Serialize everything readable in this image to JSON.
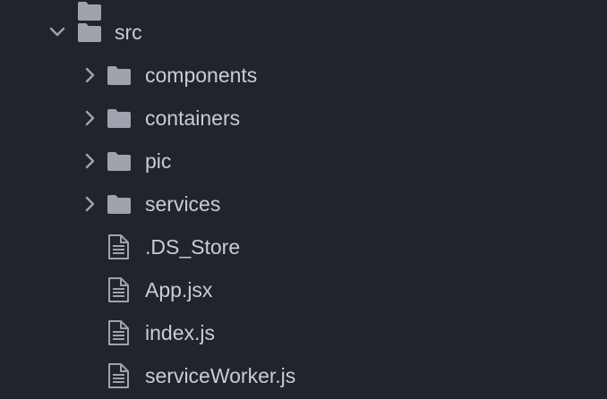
{
  "colors": {
    "background": "#21252b",
    "text": "#c8ccd4",
    "icon": "#9ea3ad",
    "chevron": "#9ea3ad"
  },
  "tree": {
    "root": {
      "label": "src",
      "expanded": true,
      "icon": "folder-icon"
    },
    "children": [
      {
        "label": "components",
        "type": "folder",
        "expanded": false,
        "icon": "folder-icon"
      },
      {
        "label": "containers",
        "type": "folder",
        "expanded": false,
        "icon": "folder-icon"
      },
      {
        "label": "pic",
        "type": "folder",
        "expanded": false,
        "icon": "folder-icon"
      },
      {
        "label": "services",
        "type": "folder",
        "expanded": false,
        "icon": "folder-icon"
      },
      {
        "label": ".DS_Store",
        "type": "file",
        "icon": "file-icon"
      },
      {
        "label": "App.jsx",
        "type": "file",
        "icon": "file-icon"
      },
      {
        "label": "index.js",
        "type": "file",
        "icon": "file-icon"
      },
      {
        "label": "serviceWorker.js",
        "type": "file",
        "icon": "file-icon"
      }
    ]
  }
}
